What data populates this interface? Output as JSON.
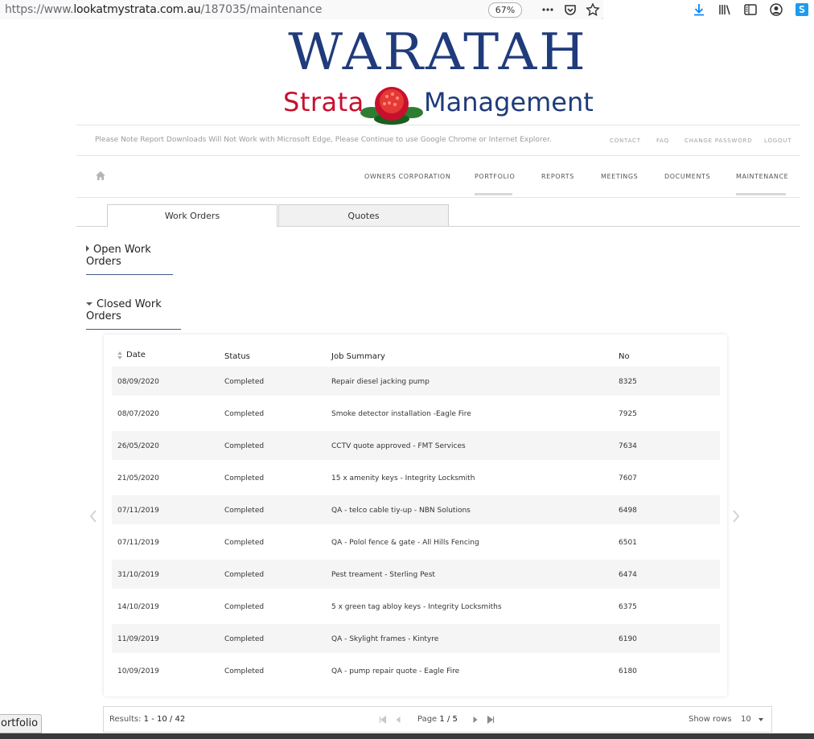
{
  "browser": {
    "url_prefix": "https://www.",
    "url_domain": "lookatmystrata.com.au",
    "url_path": "/187035/maintenance",
    "zoom": "67%"
  },
  "logo": {
    "top": "WARATAH",
    "left": "Strata",
    "right": "Management"
  },
  "notice": "Please Note Report Downloads Will Not Work with Microsoft Edge, Please Continue to use Google Chrome or Internet Explorer.",
  "top_links": [
    "CONTACT",
    "FAQ",
    "CHANGE PASSWORD",
    "LOGOUT"
  ],
  "nav": [
    "OWNERS CORPORATION",
    "PORTFOLIO",
    "REPORTS",
    "MEETINGS",
    "DOCUMENTS",
    "MAINTENANCE"
  ],
  "tabs": [
    "Work Orders",
    "Quotes"
  ],
  "sections": {
    "open": "Open Work Orders",
    "closed": "Closed Work Orders"
  },
  "table": {
    "headers": [
      "Date",
      "Status",
      "Job Summary",
      "No"
    ],
    "rows": [
      [
        "08/09/2020",
        "Completed",
        "Repair diesel jacking pump",
        "8325"
      ],
      [
        "08/07/2020",
        "Completed",
        "Smoke detector installation -Eagle Fire",
        "7925"
      ],
      [
        "26/05/2020",
        "Completed",
        "CCTV quote approved - FMT Services",
        "7634"
      ],
      [
        "21/05/2020",
        "Completed",
        "15 x amenity keys - Integrity Locksmith",
        "7607"
      ],
      [
        "07/11/2019",
        "Completed",
        "QA - telco cable tiy-up - NBN Solutions",
        "6498"
      ],
      [
        "07/11/2019",
        "Completed",
        "QA - Polol fence & gate - All Hills Fencing",
        "6501"
      ],
      [
        "31/10/2019",
        "Completed",
        "Pest treament - Sterling Pest",
        "6474"
      ],
      [
        "14/10/2019",
        "Completed",
        "5 x green tag abloy keys - Integrity Locksmiths",
        "6375"
      ],
      [
        "11/09/2019",
        "Completed",
        "QA - Skylight frames - Kintyre",
        "6190"
      ],
      [
        "10/09/2019",
        "Completed",
        "QA - pump repair quote - Eagle Fire",
        "6180"
      ]
    ]
  },
  "pager": {
    "results_label": "Results:",
    "results_value": "1 - 10 / 42",
    "page_label": "Page",
    "page_value": "1 / 5",
    "rows_label": "Show rows",
    "rows_value": "10"
  },
  "status_tooltip": "ortfolio",
  "colors": {
    "brand_blue": "#1f3b7c",
    "brand_red": "#c8102e",
    "row_alt": "#f5f5f5"
  }
}
